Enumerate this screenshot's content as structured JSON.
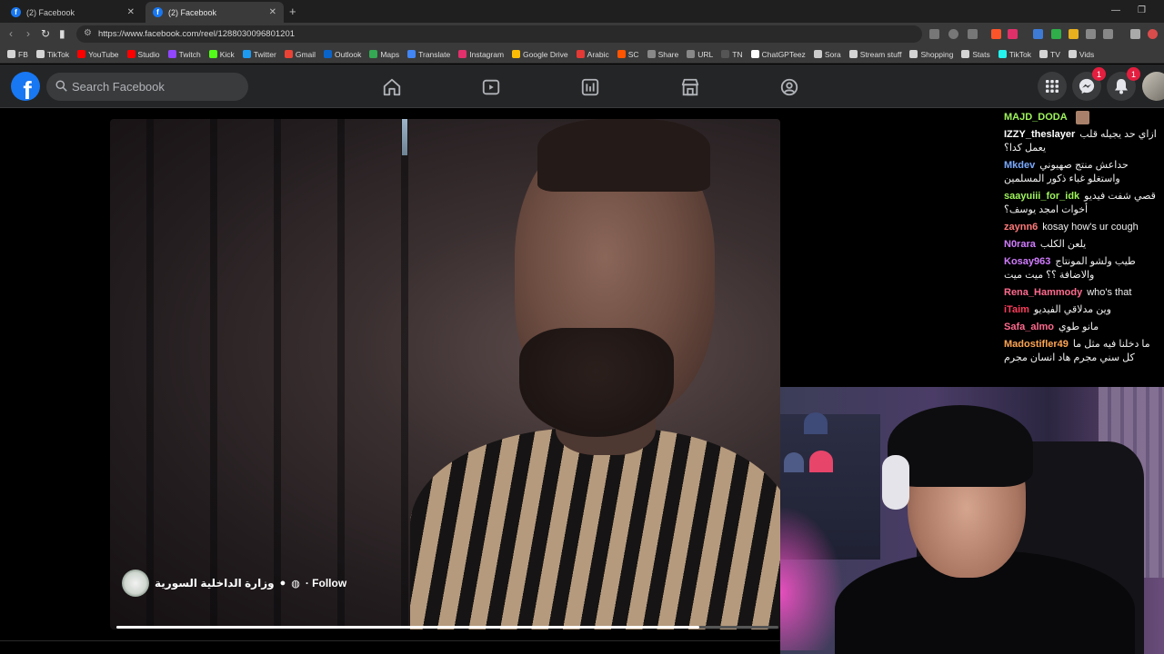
{
  "browser": {
    "tabs": [
      {
        "title": "(2) Facebook",
        "active": false
      },
      {
        "title": "(2) Facebook",
        "active": true
      }
    ],
    "new_tab_glyph": "+",
    "url": "https://www.facebook.com/reel/1288030096801201",
    "bookmarks": [
      {
        "label": "FB",
        "icon": "folder-icon"
      },
      {
        "label": "TikTok",
        "icon": "folder-icon"
      },
      {
        "label": "YouTube",
        "icon": "youtube-icon"
      },
      {
        "label": "Studio",
        "icon": "youtube-icon"
      },
      {
        "label": "Twitch",
        "icon": "twitch-icon"
      },
      {
        "label": "Kick",
        "icon": "kick-icon"
      },
      {
        "label": "Twitter",
        "icon": "twitter-icon"
      },
      {
        "label": "Gmail",
        "icon": "gmail-icon"
      },
      {
        "label": "Outlook",
        "icon": "outlook-icon"
      },
      {
        "label": "Maps",
        "icon": "maps-icon"
      },
      {
        "label": "Translate",
        "icon": "translate-icon"
      },
      {
        "label": "Instagram",
        "icon": "instagram-icon"
      },
      {
        "label": "Google Drive",
        "icon": "drive-icon"
      },
      {
        "label": "Arabic",
        "icon": "arabic-icon"
      },
      {
        "label": "SC",
        "icon": "sc-icon"
      },
      {
        "label": "Share",
        "icon": "share-icon"
      },
      {
        "label": "URL",
        "icon": "url-icon"
      },
      {
        "label": "TN",
        "icon": "tn-icon"
      },
      {
        "label": "ChatGPTeez",
        "icon": "chatgpt-icon"
      },
      {
        "label": "Sora",
        "icon": "sora-icon"
      },
      {
        "label": "Stream stuff",
        "icon": "folder-icon"
      },
      {
        "label": "Shopping",
        "icon": "folder-icon"
      },
      {
        "label": "Stats",
        "icon": "folder-icon"
      },
      {
        "label": "TikTok",
        "icon": "tiktok-icon"
      },
      {
        "label": "TV",
        "icon": "folder-icon"
      },
      {
        "label": "Vids",
        "icon": "folder-icon"
      }
    ]
  },
  "facebook": {
    "logo": "f",
    "search_placeholder": "Search Facebook",
    "messenger_badge": "1",
    "notifications_badge": "1"
  },
  "reel": {
    "page_name": "وزارة الداخلية السورية",
    "follow_label": "· Follow",
    "progress": 0.88
  },
  "chat": [
    {
      "user": "MAJD_DODA",
      "color": "#9ff55c",
      "text": ""
    },
    {
      "user": "IZZY_theslayer",
      "color": "#ffffff",
      "text": "ازاي حد يجيله قلب يعمل كدا؟"
    },
    {
      "user": "Mkdev",
      "color": "#7aa9ff",
      "text": "حداعش منتج صهيوني واستغلو غباء ذكور المسلمين"
    },
    {
      "user": "saayuiii_for_idk",
      "color": "#9ff55c",
      "text": "قصي شفت فيديو أخوات امجد يوسف؟"
    },
    {
      "user": "zaynn6",
      "color": "#ff7a7a",
      "text": "kosay how's ur cough"
    },
    {
      "user": "N0rara",
      "color": "#d17cff",
      "text": "يلعن الكلب"
    },
    {
      "user": "Kosay963",
      "color": "#d17cff",
      "text": "طيب ولشو المونتاج والاضافة ؟؟ ميت ميت"
    },
    {
      "user": "Rena_Hammody",
      "color": "#ff6a8e",
      "text": "who's that"
    },
    {
      "user": "iTaim",
      "color": "#ff3b5c",
      "text": "وين مدلاقي الفيديو"
    },
    {
      "user": "Safa_almo",
      "color": "#ff6a8e",
      "text": "مانو طوي"
    },
    {
      "user": "Madostifler49",
      "color": "#ffa552",
      "text": "ما دخلنا فيه مثل ما كل سني مجرم هاد انسان مجرم"
    }
  ]
}
